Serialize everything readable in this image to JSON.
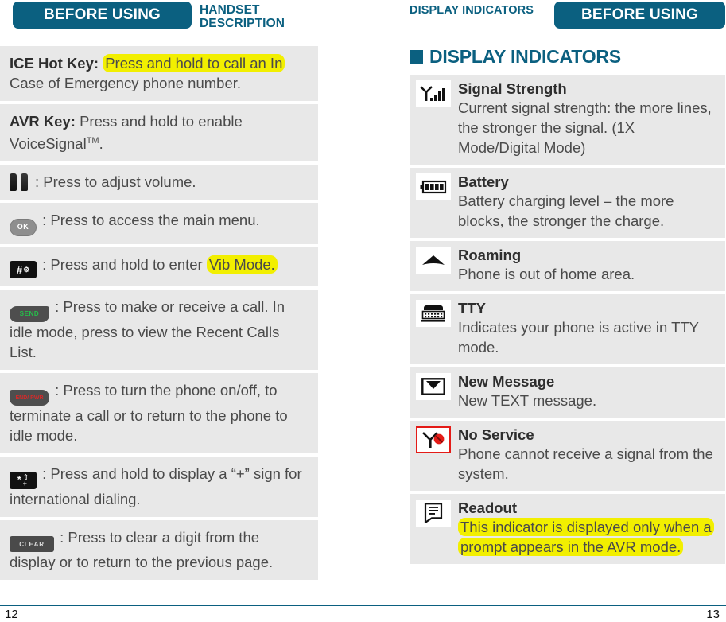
{
  "header": {
    "left_pill": "BEFORE USING",
    "left_section": "HANDSET DESCRIPTION",
    "right_section": "DISPLAY INDICATORS",
    "right_pill": "BEFORE USING"
  },
  "left_column": {
    "rows": [
      {
        "icon": "none",
        "lead": "ICE Hot Key:",
        "highlight": "Press and hold to call an In",
        "text": " Case of Emergency phone number."
      },
      {
        "icon": "none",
        "lead": "AVR Key:",
        "text": " Press and hold to enable VoiceSignal",
        "sup": "TM",
        "tail": "."
      },
      {
        "icon": "volume-key-icon",
        "text": ": Press to adjust volume."
      },
      {
        "icon": "ok-key-icon",
        "icon_label": "OK",
        "text": ": Press to access the main menu."
      },
      {
        "icon": "hash-key-icon",
        "icon_label": "#",
        "text": ": Press and hold to enter ",
        "highlight": "Vib Mode."
      },
      {
        "icon": "send-key-icon",
        "icon_label": "SEND",
        "text": ": Press to make or receive a call. In idle mode, press to view the Recent Calls List."
      },
      {
        "icon": "end-power-key-icon",
        "icon_label": "END/ PWR",
        "text": ": Press to turn the phone on/off, to terminate a call or to return to the phone to idle mode."
      },
      {
        "icon": "star-key-icon",
        "icon_label": "*",
        "text": ": Press and hold to display a “+” sign for international dialing."
      },
      {
        "icon": "clear-key-icon",
        "icon_label": "CLEAR",
        "text": ": Press to clear a digit from the display or to return to the previous page."
      }
    ]
  },
  "right_column": {
    "section_title": "DISPLAY INDICATORS",
    "indicators": [
      {
        "icon": "signal-strength-icon",
        "title": "Signal Strength",
        "desc": "Current signal strength: the more lines, the stronger the signal. (1X Mode/Digital Mode)",
        "selected": false,
        "highlighted": false
      },
      {
        "icon": "battery-icon",
        "title": "Battery",
        "desc": "Battery charging level – the more blocks, the stronger the charge.",
        "selected": false,
        "highlighted": false
      },
      {
        "icon": "roaming-icon",
        "title": "Roaming",
        "desc": "Phone is out of home area.",
        "selected": false,
        "highlighted": false
      },
      {
        "icon": "tty-icon",
        "title": "TTY",
        "desc": "Indicates your phone is active in TTY mode.",
        "selected": false,
        "highlighted": false
      },
      {
        "icon": "new-message-icon",
        "title": "New Message",
        "desc": "New TEXT message.",
        "selected": false,
        "highlighted": false
      },
      {
        "icon": "no-service-icon",
        "title": "No Service",
        "desc": "Phone cannot receive a signal from the system.",
        "selected": true,
        "highlighted": false
      },
      {
        "icon": "readout-icon",
        "title": "Readout",
        "desc": "This indicator is displayed only when a prompt appears in the AVR mode.",
        "selected": false,
        "highlighted": true
      }
    ]
  },
  "footer": {
    "page_left": "12",
    "page_right": "13"
  },
  "colors": {
    "accent_teal": "#0b6080",
    "row_gray": "#e8e8e8",
    "highlight_yellow": "#f2ef00",
    "selection_red": "#e41b17"
  }
}
